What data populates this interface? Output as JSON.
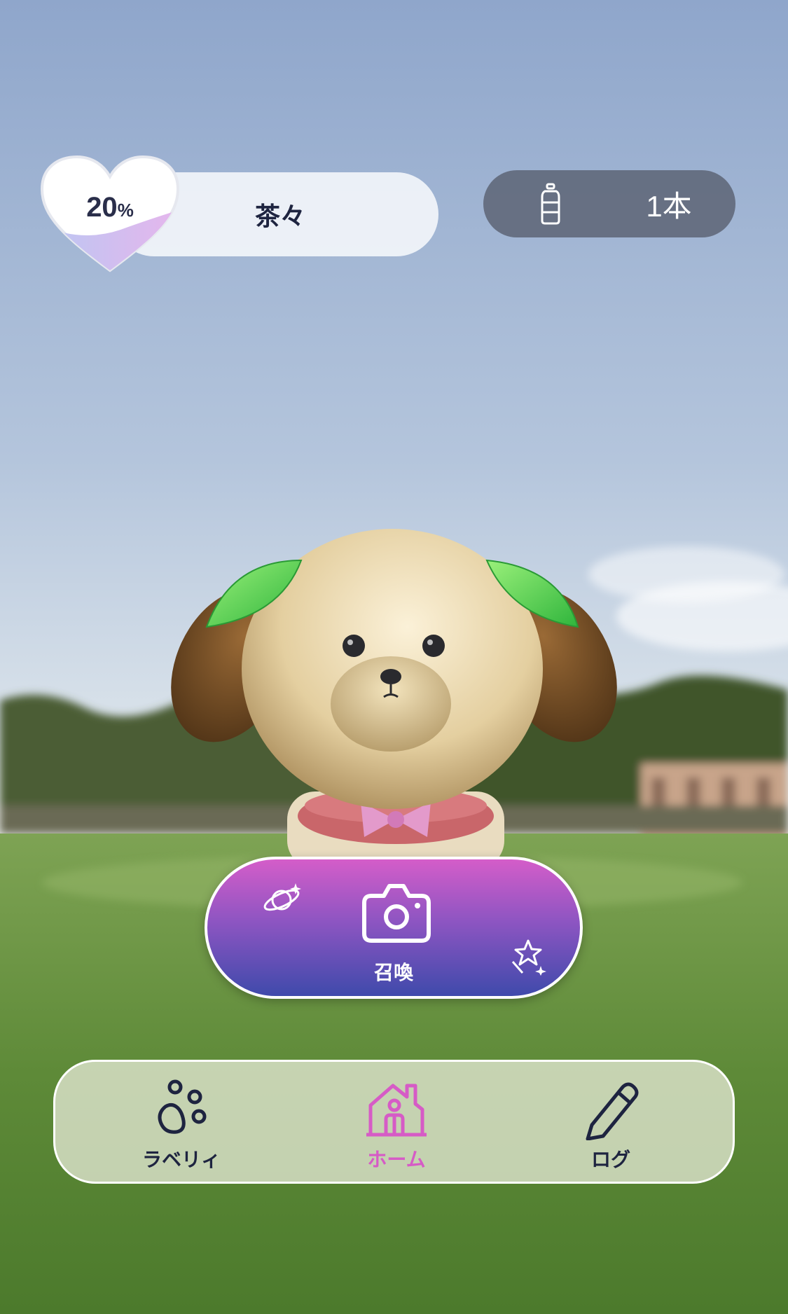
{
  "status": {
    "affection_percent": "20",
    "affection_unit": "%",
    "pet_name": "茶々",
    "bottle_count": "1本"
  },
  "summon_button": {
    "label": "召喚"
  },
  "nav": {
    "items": [
      {
        "label": "ラベリィ",
        "icon": "paw-icon",
        "active": false
      },
      {
        "label": "ホーム",
        "icon": "home-icon",
        "active": true
      },
      {
        "label": "ログ",
        "icon": "pencil-icon",
        "active": false
      }
    ]
  },
  "colors": {
    "accent_pink": "#d65bc6",
    "summon_gradient_top": "#d45dc9",
    "summon_gradient_bottom": "#3f4aab",
    "text_dark": "#1e2440",
    "bottle_pill": "#626a7c"
  }
}
